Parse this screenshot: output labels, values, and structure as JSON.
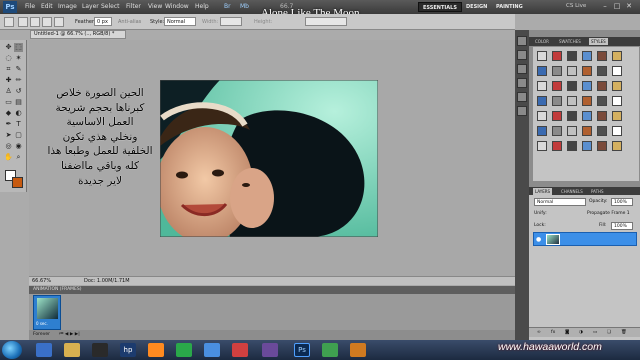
{
  "menubar": {
    "logo": "Ps",
    "items": [
      "File",
      "Edit",
      "Image",
      "Layer",
      "Select",
      "Filter",
      "View",
      "Window",
      "Help"
    ],
    "zoom": "66.7",
    "workspaces": [
      "ESSENTIALS",
      "DESIGN",
      "PAINTING"
    ],
    "cs_live": "CS Live"
  },
  "options": {
    "feather_label": "Feather:",
    "feather_value": "0 px",
    "anti_alias": "Anti-alias",
    "style_label": "Style:",
    "style_value": "Normal",
    "width_label": "Width:",
    "height_label": "Height:"
  },
  "document": {
    "tab_title": "Untitled-1 @ 66.7% (.., RGB/8) *",
    "zoom": "66.67%",
    "doc_info": "Doc: 1.00M/1.71M"
  },
  "overlay_title": "Alone Like The Moon",
  "arabic_lines": [
    "الحين الصورة خلاص",
    "كبرناها بحجم شريحة",
    "العمل الاساسية",
    "ونخلي هذي تكون",
    "الخلفية للعمل وطبعا هذا",
    "كله وباقي مااضفنا",
    "لاير جديدة"
  ],
  "animation": {
    "title": "ANIMATION (FRAMES)",
    "frame_time": "0 sec.",
    "loop": "Forever"
  },
  "panels": {
    "styles_tabs": [
      "COLOR",
      "SWATCHES",
      "STYLES"
    ],
    "layers_tabs": [
      "LAYERS",
      "CHANNELS",
      "PATHS"
    ],
    "blend_mode": "Normal",
    "opacity_label": "Opacity:",
    "opacity_value": "100%",
    "lock_label": "Lock:",
    "fill_label": "Fill:",
    "fill_value": "100%",
    "unify_label": "Unify:",
    "propagate": "Propagate Frame 1",
    "swatch_colors": [
      "#d9d9d9",
      "#c23b3b",
      "#444444",
      "#5a8fd0",
      "#7a4a3a",
      "#d4b060",
      "#3a6ab0",
      "#8a8a8a",
      "#c0c0c0",
      "#b06030",
      "#505050",
      "#ffffff"
    ]
  },
  "taskbar": {
    "watermark": "www.hawaaworld.com"
  }
}
